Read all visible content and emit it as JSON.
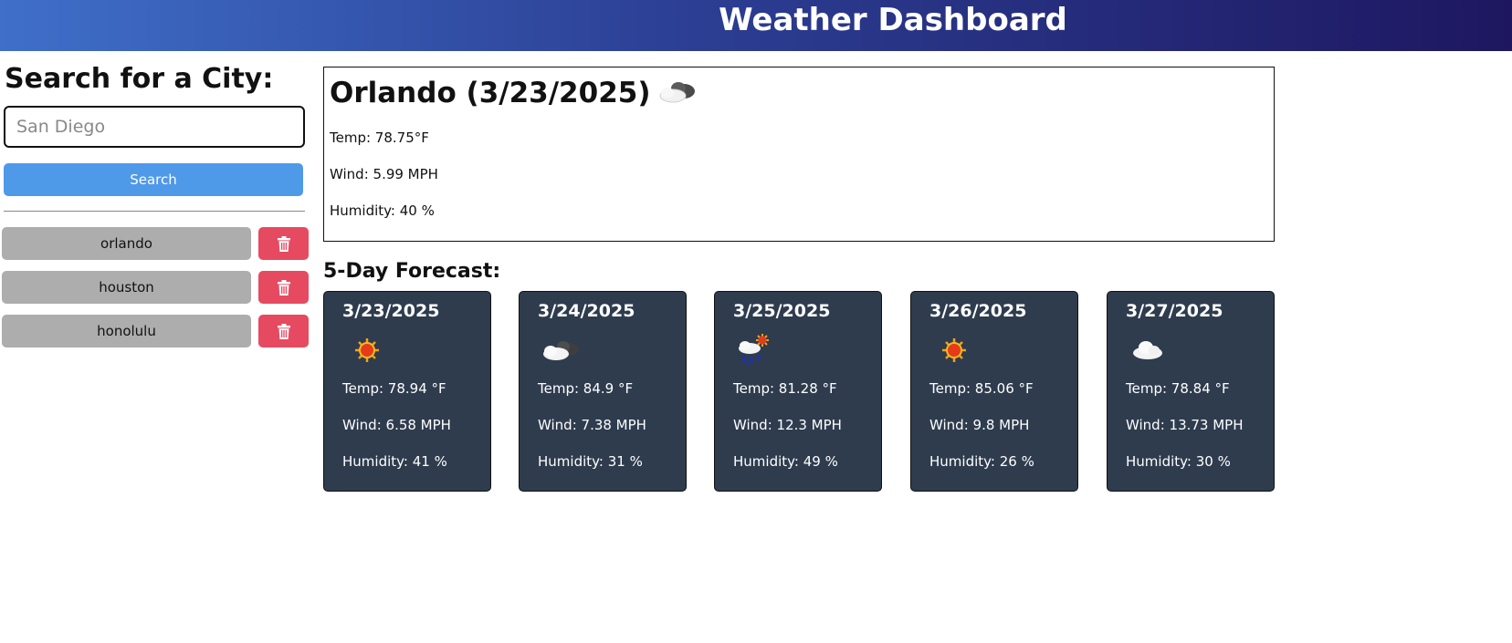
{
  "header": {
    "title": "Weather Dashboard"
  },
  "sidebar": {
    "heading": "Search for a City:",
    "search_placeholder": "San Diego",
    "search_button": "Search",
    "history": [
      "orlando",
      "houston",
      "honolulu"
    ]
  },
  "current": {
    "title": "Orlando (3/23/2025)",
    "icon": "partly-cloudy-icon",
    "temp": "Temp: 78.75°F",
    "wind": "Wind: 5.99 MPH",
    "humidity": "Humidity: 40 %"
  },
  "forecast": {
    "heading": "5-Day Forecast:",
    "days": [
      {
        "date": "3/23/2025",
        "icon": "sun-icon",
        "temp": "Temp: 78.94 °F",
        "wind": "Wind: 6.58 MPH",
        "humidity": "Humidity: 41 %"
      },
      {
        "date": "3/24/2025",
        "icon": "partly-cloudy-icon",
        "temp": "Temp: 84.9 °F",
        "wind": "Wind: 7.38 MPH",
        "humidity": "Humidity: 31 %"
      },
      {
        "date": "3/25/2025",
        "icon": "rain-sun-icon",
        "temp": "Temp: 81.28 °F",
        "wind": "Wind: 12.3 MPH",
        "humidity": "Humidity: 49 %"
      },
      {
        "date": "3/26/2025",
        "icon": "sun-icon",
        "temp": "Temp: 85.06 °F",
        "wind": "Wind: 9.8 MPH",
        "humidity": "Humidity: 26 %"
      },
      {
        "date": "3/27/2025",
        "icon": "cloud-icon",
        "temp": "Temp: 78.84 °F",
        "wind": "Wind: 13.73 MPH",
        "humidity": "Humidity: 30 %"
      }
    ]
  },
  "colors": {
    "search_button": "#4f99e9",
    "history_button": "#adadad",
    "delete_button": "#e64a61",
    "card_bg": "#2e3c4e"
  }
}
